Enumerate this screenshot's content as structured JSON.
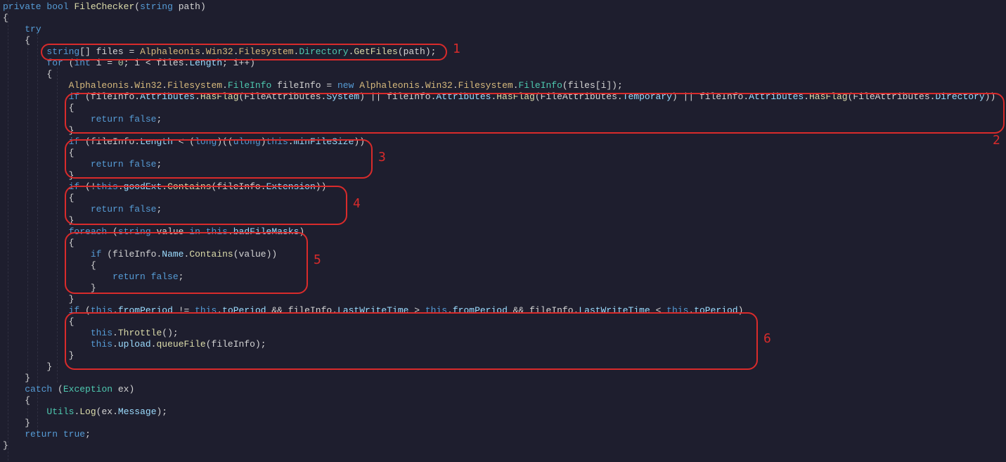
{
  "code": {
    "l1_private": "private",
    "l1_bool": "bool",
    "l1_fn": "FileChecker",
    "l1_string": "string",
    "l1_path": "path",
    "l3_try": "try",
    "l5_string": "string",
    "l5_files": "files",
    "l5_ns1": "Alphaleonis",
    "l5_ns2": "Win32",
    "l5_ns3": "Filesystem",
    "l5_dir": "Directory",
    "l5_getfiles": "GetFiles",
    "l5_path": "path",
    "l6_for": "for",
    "l6_int": "int",
    "l6_i": "i",
    "l6_zero": "0",
    "l6_files": "files",
    "l6_length": "Length",
    "l8_ns1": "Alphaleonis",
    "l8_ns2": "Win32",
    "l8_ns3": "Filesystem",
    "l8_fi": "FileInfo",
    "l8_var": "fileInfo",
    "l8_new": "new",
    "l8_ns1b": "Alphaleonis",
    "l8_ns2b": "Win32",
    "l8_ns3b": "Filesystem",
    "l8_fib": "FileInfo",
    "l8_files": "files",
    "l8_i": "i",
    "l9_if": "if",
    "l9_fi1": "fileInfo",
    "l9_attr1": "Attributes",
    "l9_has1": "HasFlag",
    "l9_fa1": "FileAttributes",
    "l9_sys": "System",
    "l9_fi2": "fileInfo",
    "l9_attr2": "Attributes",
    "l9_has2": "HasFlag",
    "l9_fa2": "FileAttributes",
    "l9_temp": "Temporary",
    "l9_fi3": "fileInfo",
    "l9_attr3": "Attributes",
    "l9_has3": "HasFlag",
    "l9_fa3": "FileAttributes",
    "l9_dir": "Directory",
    "l11_return": "return",
    "l11_false": "false",
    "l13_if": "if",
    "l13_fi": "fileInfo",
    "l13_len": "Length",
    "l13_long": "long",
    "l13_ulong": "ulong",
    "l13_this": "this",
    "l13_min": "minFileSize",
    "l15_return": "return",
    "l15_false": "false",
    "l17_if": "if",
    "l17_this": "this",
    "l17_good": "goodExt",
    "l17_contains": "Contains",
    "l17_fi": "fileInfo",
    "l17_ext": "Extension",
    "l19_return": "return",
    "l19_false": "false",
    "l21_foreach": "foreach",
    "l21_string": "string",
    "l21_value": "value",
    "l21_in": "in",
    "l21_this": "this",
    "l21_bad": "badFileMasks",
    "l23_if": "if",
    "l23_fi": "fileInfo",
    "l23_name": "Name",
    "l23_contains": "Contains",
    "l23_value": "value",
    "l25_return": "return",
    "l25_false": "false",
    "l28_if": "if",
    "l28_this1": "this",
    "l28_from1": "fromPeriod",
    "l28_this2": "this",
    "l28_to1": "toPeriod",
    "l28_fi1": "fileInfo",
    "l28_lwt1": "LastWriteTime",
    "l28_this3": "this",
    "l28_from2": "fromPeriod",
    "l28_fi2": "fileInfo",
    "l28_lwt2": "LastWriteTime",
    "l28_this4": "this",
    "l28_to2": "toPeriod",
    "l30_this": "this",
    "l30_throttle": "Throttle",
    "l31_this": "this",
    "l31_upload": "upload",
    "l31_queue": "queueFile",
    "l31_fi": "fileInfo",
    "l35_catch": "catch",
    "l35_exc": "Exception",
    "l35_ex": "ex",
    "l37_utils": "Utils",
    "l37_log": "Log",
    "l37_ex": "ex",
    "l37_msg": "Message",
    "l39_return": "return",
    "l39_true": "true"
  },
  "annotations": {
    "a1": "1",
    "a2": "2",
    "a3": "3",
    "a4": "4",
    "a5": "5",
    "a6": "6"
  }
}
